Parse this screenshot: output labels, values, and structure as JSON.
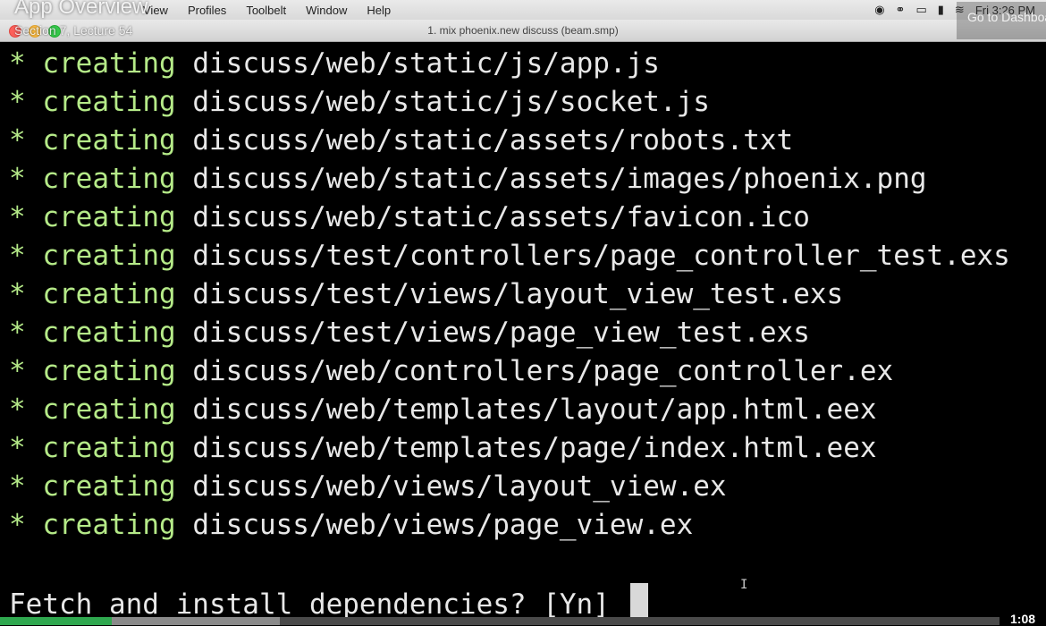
{
  "menubar": {
    "items": [
      "View",
      "Profiles",
      "Toolbelt",
      "Window",
      "Help"
    ],
    "clock": "Fri 3:26 PM"
  },
  "window": {
    "title": "1. mix phoenix.new discuss (beam.smp)"
  },
  "overlay": {
    "title": "App Overview",
    "subtitle": "Section 7, Lecture 54",
    "dashboard_button": "Go to Dashboard"
  },
  "terminal": {
    "marker": "*",
    "verb": "creating",
    "lines": [
      "discuss/web/static/js/app.js",
      "discuss/web/static/js/socket.js",
      "discuss/web/static/assets/robots.txt",
      "discuss/web/static/assets/images/phoenix.png",
      "discuss/web/static/assets/favicon.ico",
      "discuss/test/controllers/page_controller_test.exs",
      "discuss/test/views/layout_view_test.exs",
      "discuss/test/views/page_view_test.exs",
      "discuss/web/controllers/page_controller.ex",
      "discuss/web/templates/layout/app.html.eex",
      "discuss/web/templates/page/index.html.eex",
      "discuss/web/views/layout_view.ex",
      "discuss/web/views/page_view.ex"
    ],
    "prompt": "Fetch and install dependencies? [Yn] "
  },
  "video": {
    "progress_fraction": 0.112,
    "buffered_fraction": 0.28,
    "time": "1:08"
  }
}
